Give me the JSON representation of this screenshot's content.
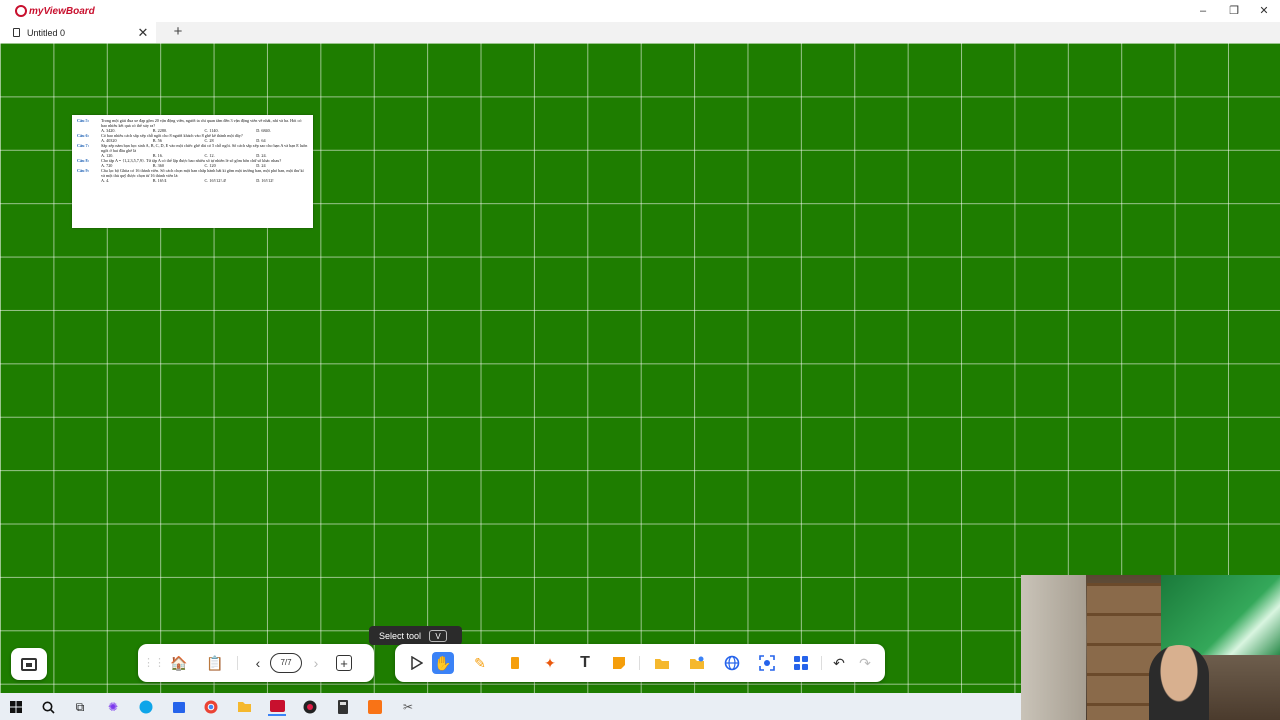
{
  "app": {
    "name": "myViewBoard"
  },
  "window_controls": {
    "minimize": "–",
    "maximize": "❐",
    "close": "✕"
  },
  "tabs": [
    {
      "title": "Untitled 0",
      "close": "✕"
    }
  ],
  "new_tab": "+",
  "document": {
    "questions": [
      {
        "num": "Câu 5:",
        "text": "Trong một giải đua xe đạp gồm 20 vận động viên, người ta chỉ quan tâm đến 3 vận động viên về nhất, nhì và ba. Hỏi có bao nhiêu kết quả có thể xảy ra?",
        "answers": [
          "A. 3420.",
          "B. 2280.",
          "C. 1140.",
          "D. 6840."
        ]
      },
      {
        "num": "Câu 6:",
        "text": "Có bao nhiêu cách sắp xếp chỗ ngồi cho 8 người khách vào 8 ghế kê thành một dãy?",
        "answers": [
          "A. 40320",
          "B. 56",
          "C. 28",
          "D. 64"
        ]
      },
      {
        "num": "Câu 7:",
        "text": "Sắp xếp năm bạn học sinh A, B, C, D, E vào một chiếc ghế dài có 5 chỗ ngồi. Số cách sắp xếp sao cho bạn A và bạn E luôn ngồi ở hai đầu ghế là",
        "answers": [
          "A. 120.",
          "B. 16.",
          "C. 12.",
          "D. 24."
        ]
      },
      {
        "num": "Câu 8:",
        "text": "Cho tập A = {1,2,3,5,7,9}. Từ tập A có thể lập được bao nhiêu số tự nhiên lẻ số gồm bốn chữ số khác nhau?",
        "answers": [
          "A. 720",
          "B. 360",
          "C. 120",
          "D. 24"
        ]
      },
      {
        "num": "Câu 9:",
        "text": "Câu lạc bộ Ghita có 16 thành viên. Số cách chọn một ban chấp hành bất kì gồm một trưởng ban, một phó ban, một thư kí và một thủ quỹ được chọn từ 16 thành viên là:",
        "answers": [
          "A. 4.",
          "B. 16!/4",
          "C. 16!/12!.4!",
          "D. 16!/12!"
        ]
      }
    ]
  },
  "tooltip": {
    "label": "Select tool",
    "shortcut": "V"
  },
  "pagebar": {
    "page_indicator": "7/7",
    "prev": "‹",
    "next": "›",
    "add": "+"
  },
  "toolbar": {
    "icons": [
      "select-arrow-icon",
      "hand-icon",
      "pen-icon",
      "eraser-icon",
      "magic-tools-icon",
      "text-icon",
      "sticky-note-icon",
      "folder-icon",
      "add-image-icon",
      "web-browser-icon",
      "screen-capture-icon",
      "apps-grid-icon",
      "undo-icon",
      "redo-icon"
    ]
  },
  "colors": {
    "canvas": "#1e7d00",
    "accent": "#3b82f6",
    "brand": "#c8102e"
  }
}
